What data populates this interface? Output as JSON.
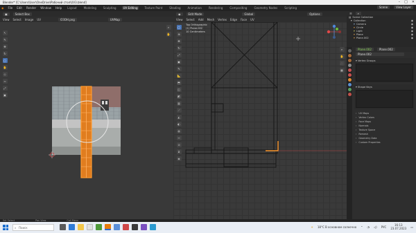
{
  "window": {
    "title": "Blender* [C:\\Users\\User\\OneDrive\\Рабочий стол\\UV3.blend]"
  },
  "topbar": {
    "menus": [
      "File",
      "Edit",
      "Render",
      "Window",
      "Help"
    ],
    "workspaces": [
      "Layout",
      "Modeling",
      "Sculpting",
      "UV Editing",
      "Texture Paint",
      "Shading",
      "Animation",
      "Rendering",
      "Compositing",
      "Geometry Nodes",
      "Scripting"
    ],
    "active_workspace": "UV Editing",
    "scene": "Scene",
    "view_layer": "View Layer"
  },
  "uv_editor": {
    "header_mode": "UV",
    "view_label": "View",
    "select_label": "Select",
    "image_label": "Image",
    "uv_label": "UV",
    "image_name": "ОЗОН.png",
    "uvmap_label": "UVMap",
    "select_box": "Select Box",
    "colors": {
      "selected": "#ff8a1f",
      "bg": "#393939"
    }
  },
  "viewport": {
    "mode": "Edit Mode",
    "view_label": "View",
    "select_label": "Select",
    "add_label": "Add",
    "mesh_label": "Mesh",
    "vertex_label": "Vertex",
    "edge_label": "Edge",
    "face_label": "Face",
    "uv_label": "UV",
    "global_label": "Global",
    "options_label": "Options",
    "overlay_lines": [
      "Top Orthographic",
      "(1) Plane.002",
      "10 Centimeters"
    ]
  },
  "outliner": {
    "header": "Scene Collection",
    "items": [
      {
        "name": "Collection",
        "color": "#c8c8c8"
      },
      {
        "name": "Camera",
        "color": "#8db0d8"
      },
      {
        "name": "Circle",
        "color": "#e0a050"
      },
      {
        "name": "Light",
        "color": "#c8c860"
      },
      {
        "name": "Plane",
        "color": "#e0a050"
      },
      {
        "name": "Plane.002",
        "color": "#e0a050"
      }
    ]
  },
  "properties": {
    "object_name": "Plane.002",
    "mesh_name": "Plane.002",
    "data_name": "Plane.002",
    "sections": [
      {
        "label": "Vertex Groups",
        "expanded": true
      },
      {
        "label": "Shape Keys",
        "expanded": true
      }
    ],
    "collapsed": [
      "UV Maps",
      "Vertex Colors",
      "Face Maps",
      "Normals",
      "Texture Space",
      "Remesh",
      "Geometry Data",
      "Custom Properties"
    ]
  },
  "statusbar": {
    "select": "Set Select",
    "pan": "Pan View",
    "menu": "Call Menu"
  },
  "taskbar": {
    "search_placeholder": "Поиск",
    "weather": "18°C  В основном солнечно",
    "lang": "РУС",
    "time": "16:13",
    "date": "23.07.2023"
  }
}
